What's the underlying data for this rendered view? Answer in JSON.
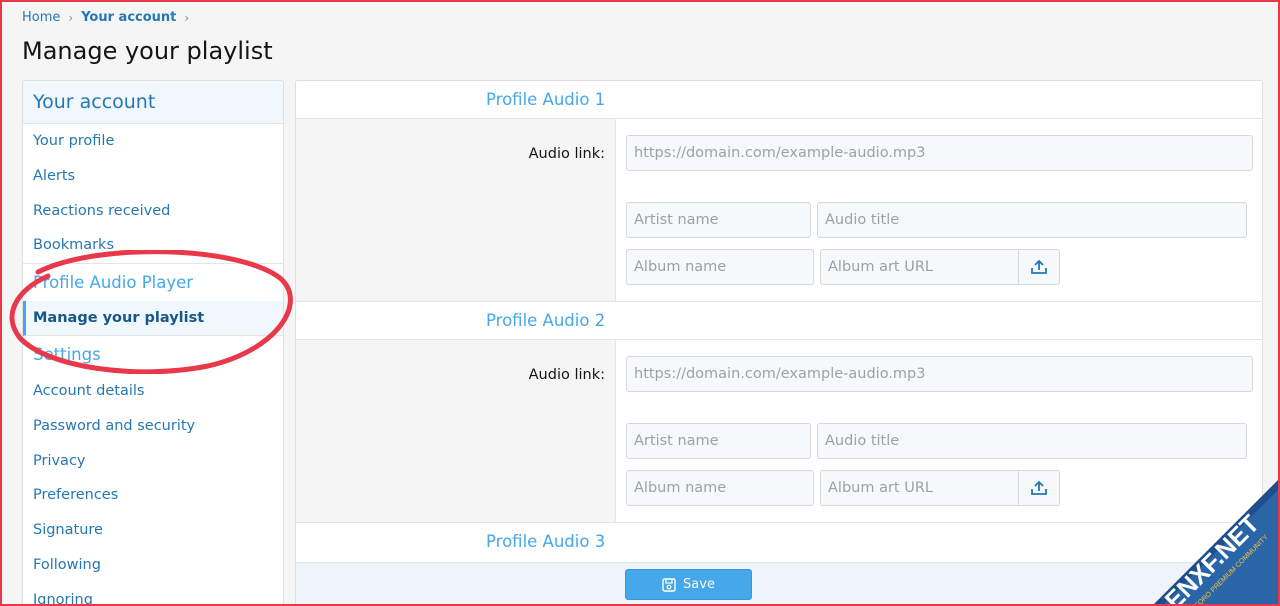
{
  "breadcrumb": {
    "home": "Home",
    "current": "Your account"
  },
  "page": {
    "title": "Manage your playlist"
  },
  "sidebar": {
    "heading": "Your account",
    "items_top": [
      "Your profile",
      "Alerts",
      "Reactions received",
      "Bookmarks"
    ],
    "category_audio": "Profile Audio Player",
    "active_item": "Manage your playlist",
    "category_settings": "Settings",
    "items_settings": [
      "Account details",
      "Password and security",
      "Privacy",
      "Preferences",
      "Signature",
      "Following",
      "Ignoring"
    ]
  },
  "sections": [
    {
      "title": "Profile Audio 1",
      "audio_label": "Audio link:",
      "audio_placeholder": "https://domain.com/example-audio.mp3",
      "artist_placeholder": "Artist name",
      "title_placeholder": "Audio title",
      "album_placeholder": "Album name",
      "art_placeholder": "Album art URL"
    },
    {
      "title": "Profile Audio 2",
      "audio_label": "Audio link:",
      "audio_placeholder": "https://domain.com/example-audio.mp3",
      "artist_placeholder": "Artist name",
      "title_placeholder": "Audio title",
      "album_placeholder": "Album name",
      "art_placeholder": "Album art URL"
    },
    {
      "title": "Profile Audio 3"
    }
  ],
  "save_label": "Save",
  "watermark": {
    "brand": "ENXF.NET",
    "tagline": "XENFORO PREMIUM COMMUNITY"
  },
  "icons": {
    "chevron": "chevron-right-icon",
    "upload": "upload-icon",
    "save": "save-icon"
  },
  "colors": {
    "link": "#2577b1",
    "accent": "#47a7eb",
    "annotation": "#e8394a"
  }
}
